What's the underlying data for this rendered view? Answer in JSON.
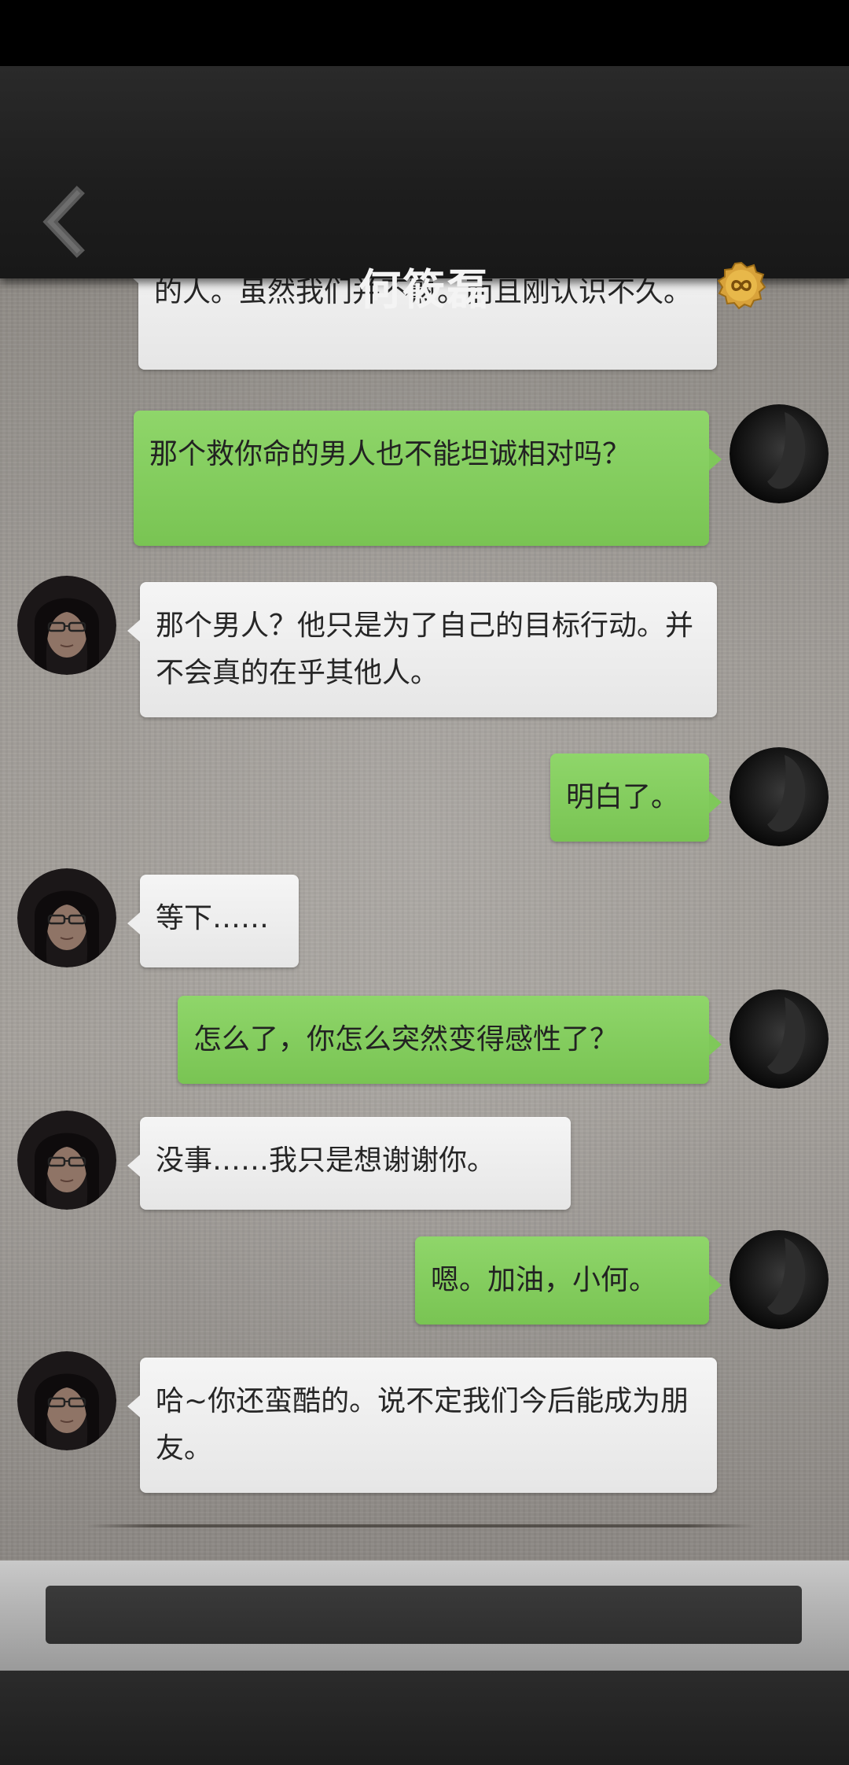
{
  "header": {
    "title": "何筱磊",
    "back_icon": "chevron-left-icon",
    "menu_icon": "infinity-badge-icon"
  },
  "input": {
    "value": "",
    "placeholder": ""
  },
  "messages": [
    {
      "side": "left",
      "text": "的人。虽然我们并不熟。而且刚认识不久。"
    },
    {
      "side": "right",
      "text": "那个救你命的男人也不能坦诚相对吗？"
    },
    {
      "side": "left",
      "text": "那个男人？他只是为了自己的目标行动。并不会真的在乎其他人。"
    },
    {
      "side": "right",
      "text": "明白了。"
    },
    {
      "side": "left",
      "text": "等下……"
    },
    {
      "side": "right",
      "text": "怎么了，你怎么突然变得感性了？"
    },
    {
      "side": "left",
      "text": "没事……我只是想谢谢你。"
    },
    {
      "side": "right",
      "text": "嗯。加油，小何。"
    },
    {
      "side": "left",
      "text": "哈~你还蛮酷的。说不定我们今后能成为朋友。"
    }
  ],
  "colors": {
    "header_bg": "#1d1d1d",
    "bubble_left": "#eeeeee",
    "bubble_right": "#7fc85a",
    "chat_bg": "#a19d98"
  }
}
